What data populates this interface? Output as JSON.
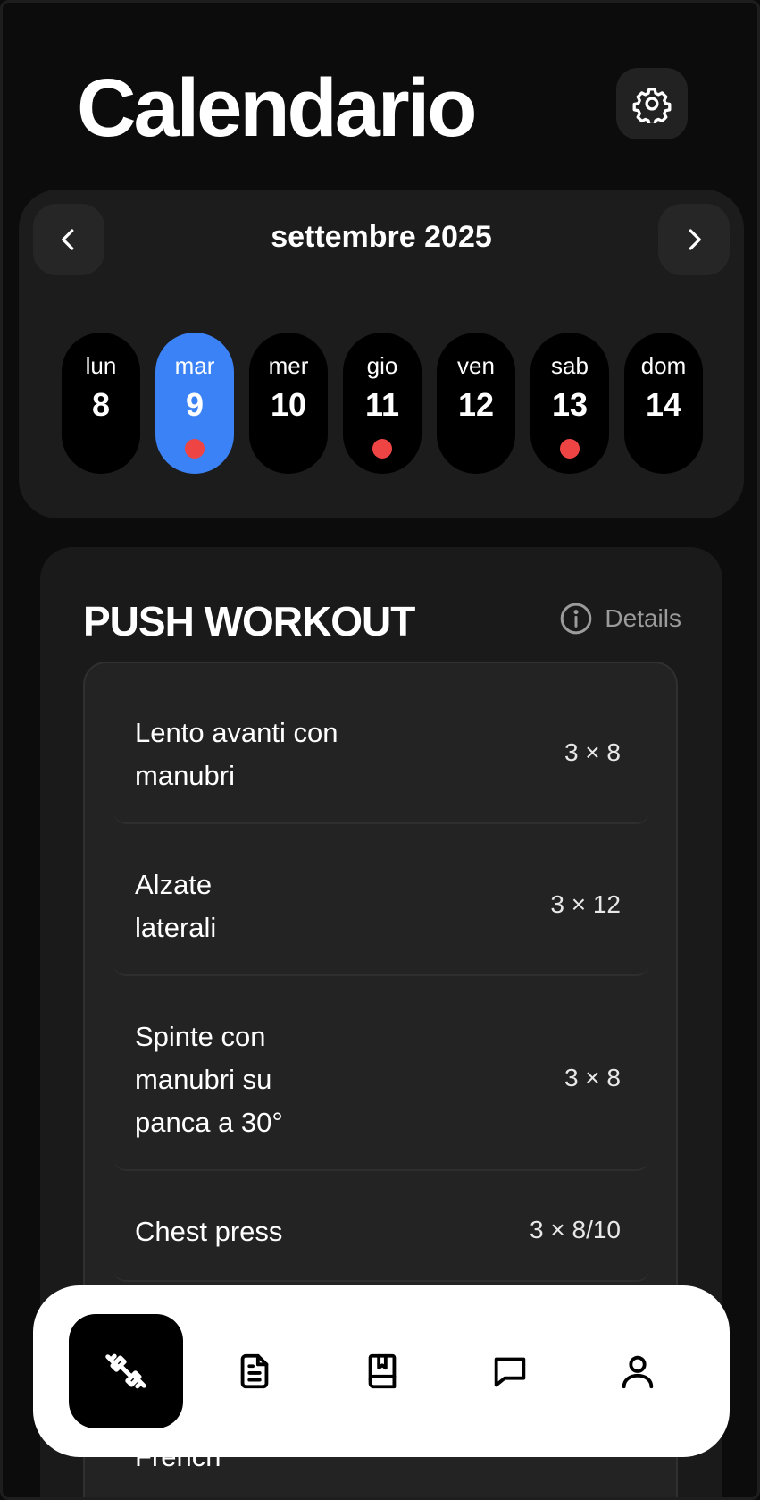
{
  "header": {
    "title": "Calendario",
    "settings_icon": "gear-icon"
  },
  "calendar": {
    "month_label": "settembre 2025",
    "prev_icon": "chevron-left-icon",
    "next_icon": "chevron-right-icon",
    "selected_color": "#3b82f6",
    "dot_color": "#ef4444",
    "days": [
      {
        "name": "lun",
        "number": "8",
        "selected": false,
        "has_workout": false
      },
      {
        "name": "mar",
        "number": "9",
        "selected": true,
        "has_workout": true
      },
      {
        "name": "mer",
        "number": "10",
        "selected": false,
        "has_workout": false
      },
      {
        "name": "gio",
        "number": "11",
        "selected": false,
        "has_workout": true
      },
      {
        "name": "ven",
        "number": "12",
        "selected": false,
        "has_workout": false
      },
      {
        "name": "sab",
        "number": "13",
        "selected": false,
        "has_workout": true
      },
      {
        "name": "dom",
        "number": "14",
        "selected": false,
        "has_workout": false
      }
    ]
  },
  "workout": {
    "title": "PUSH WORKOUT",
    "details_label": "Details",
    "details_icon": "info-icon",
    "exercises": [
      {
        "name": "Lento avanti con manubri",
        "sets": "3 × 8"
      },
      {
        "name": "Alzate laterali",
        "sets": "3 × 12"
      },
      {
        "name": "Spinte con manubri su panca a 30°",
        "sets": "3 × 8"
      },
      {
        "name": "Chest press",
        "sets": "3 × 8/10"
      }
    ],
    "partial_next": "French"
  },
  "tabbar": {
    "items": [
      {
        "icon": "dumbbell-icon",
        "active": true
      },
      {
        "icon": "document-icon",
        "active": false
      },
      {
        "icon": "book-bookmark-icon",
        "active": false
      },
      {
        "icon": "chat-bubble-icon",
        "active": false
      },
      {
        "icon": "user-icon",
        "active": false
      }
    ]
  }
}
